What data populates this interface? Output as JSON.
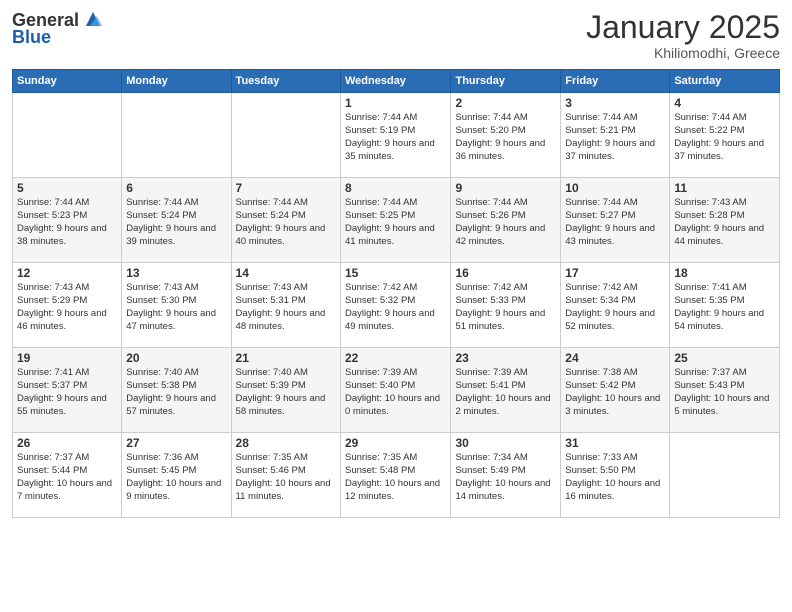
{
  "logo": {
    "general": "General",
    "blue": "Blue"
  },
  "header": {
    "month": "January 2025",
    "location": "Khiliomodhi, Greece"
  },
  "weekdays": [
    "Sunday",
    "Monday",
    "Tuesday",
    "Wednesday",
    "Thursday",
    "Friday",
    "Saturday"
  ],
  "weeks": [
    [
      {
        "day": "",
        "info": ""
      },
      {
        "day": "",
        "info": ""
      },
      {
        "day": "",
        "info": ""
      },
      {
        "day": "1",
        "info": "Sunrise: 7:44 AM\nSunset: 5:19 PM\nDaylight: 9 hours and 35 minutes."
      },
      {
        "day": "2",
        "info": "Sunrise: 7:44 AM\nSunset: 5:20 PM\nDaylight: 9 hours and 36 minutes."
      },
      {
        "day": "3",
        "info": "Sunrise: 7:44 AM\nSunset: 5:21 PM\nDaylight: 9 hours and 37 minutes."
      },
      {
        "day": "4",
        "info": "Sunrise: 7:44 AM\nSunset: 5:22 PM\nDaylight: 9 hours and 37 minutes."
      }
    ],
    [
      {
        "day": "5",
        "info": "Sunrise: 7:44 AM\nSunset: 5:23 PM\nDaylight: 9 hours and 38 minutes."
      },
      {
        "day": "6",
        "info": "Sunrise: 7:44 AM\nSunset: 5:24 PM\nDaylight: 9 hours and 39 minutes."
      },
      {
        "day": "7",
        "info": "Sunrise: 7:44 AM\nSunset: 5:24 PM\nDaylight: 9 hours and 40 minutes."
      },
      {
        "day": "8",
        "info": "Sunrise: 7:44 AM\nSunset: 5:25 PM\nDaylight: 9 hours and 41 minutes."
      },
      {
        "day": "9",
        "info": "Sunrise: 7:44 AM\nSunset: 5:26 PM\nDaylight: 9 hours and 42 minutes."
      },
      {
        "day": "10",
        "info": "Sunrise: 7:44 AM\nSunset: 5:27 PM\nDaylight: 9 hours and 43 minutes."
      },
      {
        "day": "11",
        "info": "Sunrise: 7:43 AM\nSunset: 5:28 PM\nDaylight: 9 hours and 44 minutes."
      }
    ],
    [
      {
        "day": "12",
        "info": "Sunrise: 7:43 AM\nSunset: 5:29 PM\nDaylight: 9 hours and 46 minutes."
      },
      {
        "day": "13",
        "info": "Sunrise: 7:43 AM\nSunset: 5:30 PM\nDaylight: 9 hours and 47 minutes."
      },
      {
        "day": "14",
        "info": "Sunrise: 7:43 AM\nSunset: 5:31 PM\nDaylight: 9 hours and 48 minutes."
      },
      {
        "day": "15",
        "info": "Sunrise: 7:42 AM\nSunset: 5:32 PM\nDaylight: 9 hours and 49 minutes."
      },
      {
        "day": "16",
        "info": "Sunrise: 7:42 AM\nSunset: 5:33 PM\nDaylight: 9 hours and 51 minutes."
      },
      {
        "day": "17",
        "info": "Sunrise: 7:42 AM\nSunset: 5:34 PM\nDaylight: 9 hours and 52 minutes."
      },
      {
        "day": "18",
        "info": "Sunrise: 7:41 AM\nSunset: 5:35 PM\nDaylight: 9 hours and 54 minutes."
      }
    ],
    [
      {
        "day": "19",
        "info": "Sunrise: 7:41 AM\nSunset: 5:37 PM\nDaylight: 9 hours and 55 minutes."
      },
      {
        "day": "20",
        "info": "Sunrise: 7:40 AM\nSunset: 5:38 PM\nDaylight: 9 hours and 57 minutes."
      },
      {
        "day": "21",
        "info": "Sunrise: 7:40 AM\nSunset: 5:39 PM\nDaylight: 9 hours and 58 minutes."
      },
      {
        "day": "22",
        "info": "Sunrise: 7:39 AM\nSunset: 5:40 PM\nDaylight: 10 hours and 0 minutes."
      },
      {
        "day": "23",
        "info": "Sunrise: 7:39 AM\nSunset: 5:41 PM\nDaylight: 10 hours and 2 minutes."
      },
      {
        "day": "24",
        "info": "Sunrise: 7:38 AM\nSunset: 5:42 PM\nDaylight: 10 hours and 3 minutes."
      },
      {
        "day": "25",
        "info": "Sunrise: 7:37 AM\nSunset: 5:43 PM\nDaylight: 10 hours and 5 minutes."
      }
    ],
    [
      {
        "day": "26",
        "info": "Sunrise: 7:37 AM\nSunset: 5:44 PM\nDaylight: 10 hours and 7 minutes."
      },
      {
        "day": "27",
        "info": "Sunrise: 7:36 AM\nSunset: 5:45 PM\nDaylight: 10 hours and 9 minutes."
      },
      {
        "day": "28",
        "info": "Sunrise: 7:35 AM\nSunset: 5:46 PM\nDaylight: 10 hours and 11 minutes."
      },
      {
        "day": "29",
        "info": "Sunrise: 7:35 AM\nSunset: 5:48 PM\nDaylight: 10 hours and 12 minutes."
      },
      {
        "day": "30",
        "info": "Sunrise: 7:34 AM\nSunset: 5:49 PM\nDaylight: 10 hours and 14 minutes."
      },
      {
        "day": "31",
        "info": "Sunrise: 7:33 AM\nSunset: 5:50 PM\nDaylight: 10 hours and 16 minutes."
      },
      {
        "day": "",
        "info": ""
      }
    ]
  ]
}
